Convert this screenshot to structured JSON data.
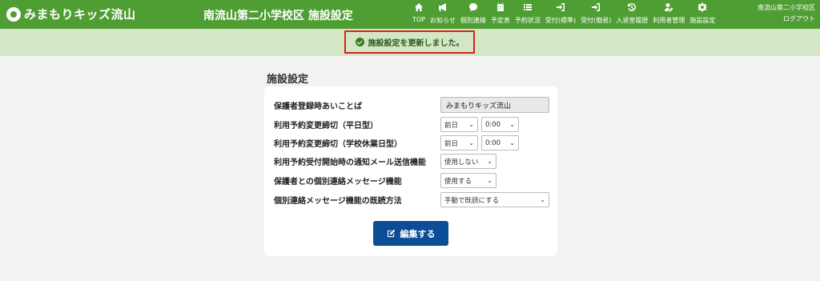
{
  "app": {
    "logo": "みまもりキッズ流山",
    "page_title": "南流山第二小学校区 施設設定"
  },
  "nav": [
    {
      "label": "TOP",
      "icon": "home-icon"
    },
    {
      "label": "お知らせ",
      "icon": "megaphone-icon"
    },
    {
      "label": "個別連絡",
      "icon": "chat-icon"
    },
    {
      "label": "予定表",
      "icon": "calendar-icon"
    },
    {
      "label": "予約状況",
      "icon": "list-icon"
    },
    {
      "label": "受付(標準)",
      "icon": "sign-in-icon"
    },
    {
      "label": "受付(簡易)",
      "icon": "sign-in-icon"
    },
    {
      "label": "入退室履歴",
      "icon": "history-icon"
    },
    {
      "label": "利用者管理",
      "icon": "user-edit-icon"
    },
    {
      "label": "施設設定",
      "icon": "gear-icon"
    }
  ],
  "school": {
    "name": "南流山第二小学校区",
    "logout": "ログアウト"
  },
  "banner": {
    "message": "施設設定を更新しました。"
  },
  "section": {
    "title": "施設設定"
  },
  "form": {
    "greeting": {
      "label": "保護者登録時あいことば",
      "value": "みまもりキッズ流山"
    },
    "weekday": {
      "label": "利用予約変更締切（平日型）",
      "day": "前日",
      "time": "0:00"
    },
    "holiday": {
      "label": "利用予約変更締切（学校休業日型）",
      "day": "前日",
      "time": "0:00"
    },
    "notify": {
      "label": "利用予約受付開始時の通知メール送信機能",
      "value": "使用しない"
    },
    "message": {
      "label": "保護者との個別連絡メッセージ機能",
      "value": "使用する"
    },
    "read": {
      "label": "個別連絡メッセージ機能の既読方法",
      "value": "手動で既読にする"
    },
    "edit_button": "編集する"
  },
  "colors": {
    "header": "#4f9e33",
    "banner": "#d3e6c5",
    "highlight": "#d9221f",
    "button": "#0b4d96"
  }
}
